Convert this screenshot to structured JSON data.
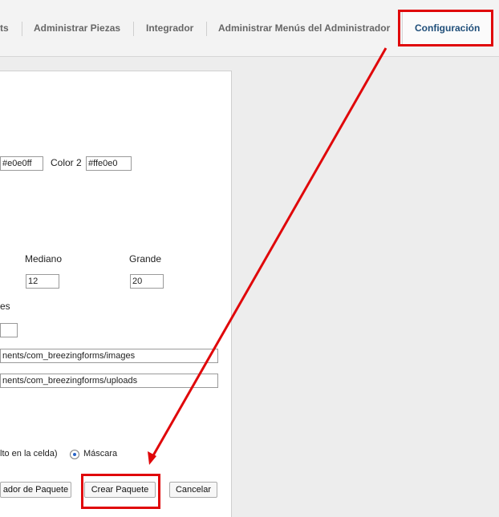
{
  "tabs": [
    {
      "label": "ts"
    },
    {
      "label": "Administrar Piezas"
    },
    {
      "label": "Integrador"
    },
    {
      "label": "Administrar Menús del Administrador"
    },
    {
      "label": "Configuración",
      "active": true
    }
  ],
  "colors": {
    "color1_value": "#e0e0ff",
    "color2_label": "Color 2",
    "color2_value": "#ffe0e0"
  },
  "sizes": {
    "medium_label": "Mediano",
    "large_label": "Grande",
    "medium_value": "12",
    "large_value": "20"
  },
  "fragment_label": "es",
  "empty_field_value": "",
  "paths": {
    "images": "nents/com_breezingforms/images",
    "uploads": "nents/com_breezingforms/uploads"
  },
  "radio_options": {
    "cell_label": "lto en la celda)",
    "mask_label": "Máscara"
  },
  "buttons": {
    "package_creator": "ador de Paquete",
    "create_package": "Crear Paquete",
    "cancel": "Cancelar"
  },
  "annotation_color": "#e0070a"
}
